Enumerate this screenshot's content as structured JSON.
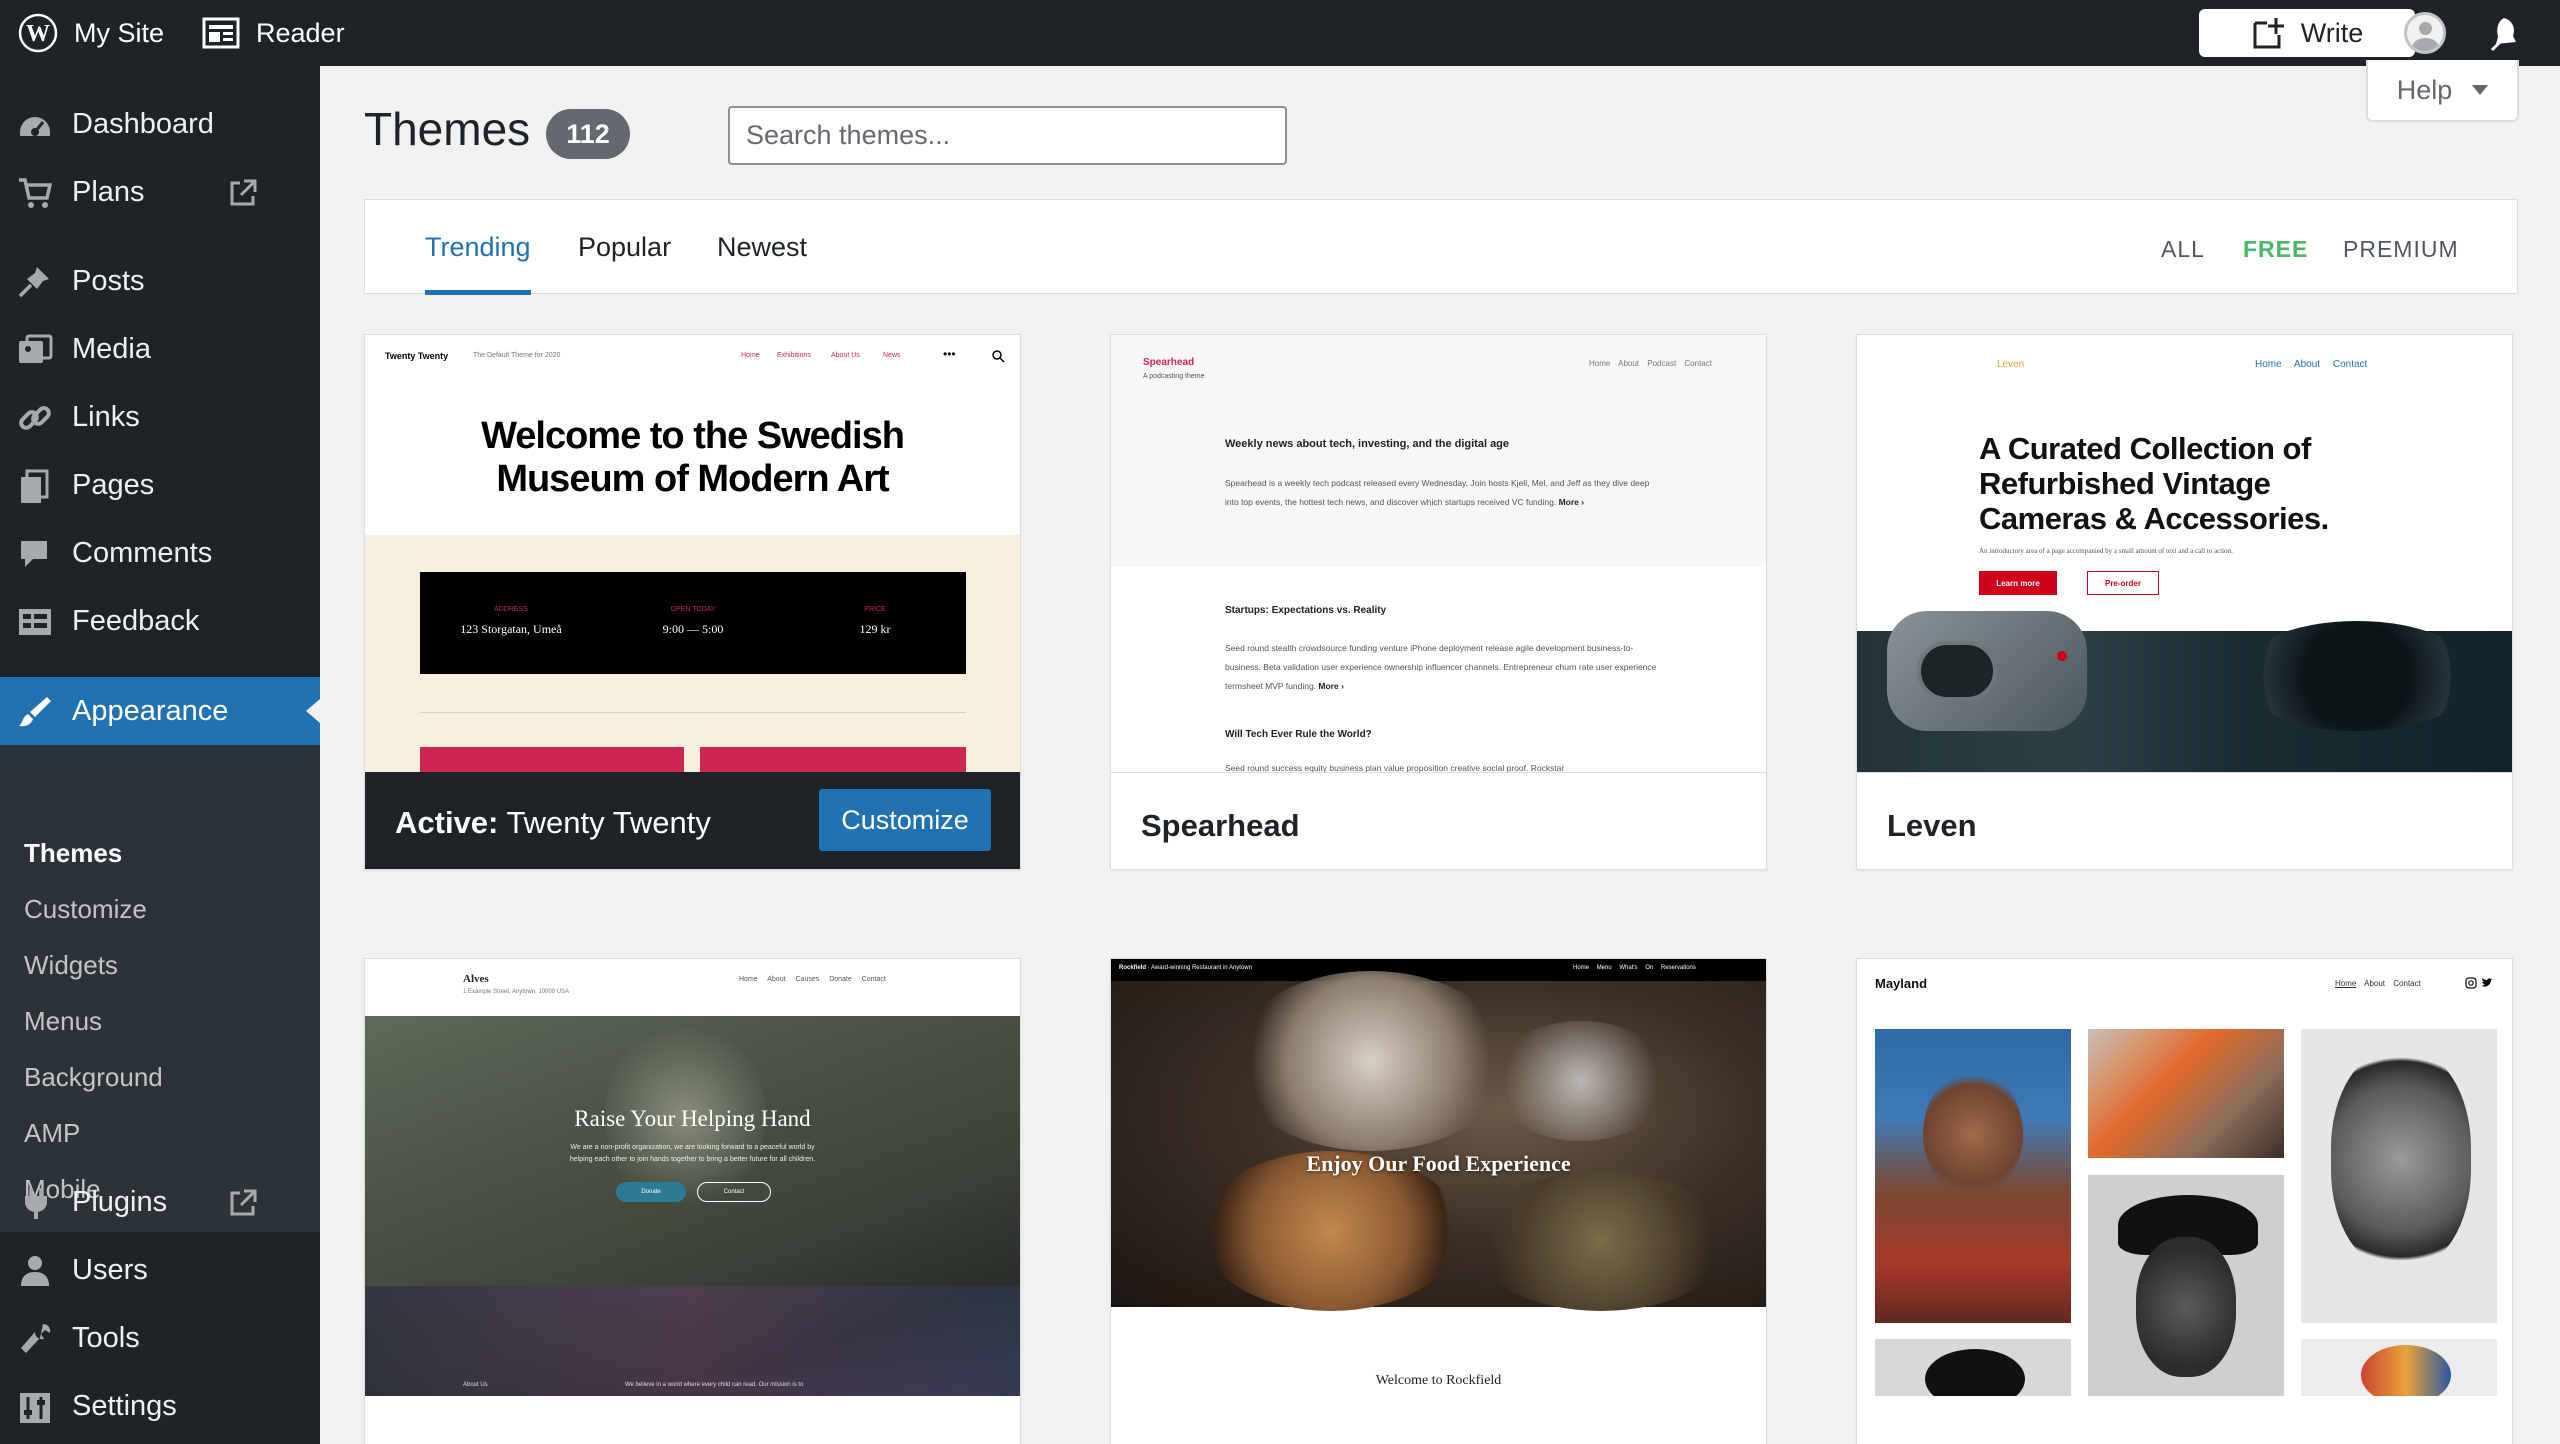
{
  "topbar": {
    "my_site": "My Site",
    "reader": "Reader",
    "write": "Write"
  },
  "sidebar": {
    "items": [
      {
        "label": "Dashboard",
        "icon": "dashboard-icon"
      },
      {
        "label": "Plans",
        "icon": "cart-icon"
      },
      {
        "label": "Posts",
        "icon": "pin-icon"
      },
      {
        "label": "Media",
        "icon": "media-icon"
      },
      {
        "label": "Links",
        "icon": "link-icon"
      },
      {
        "label": "Pages",
        "icon": "pages-icon"
      },
      {
        "label": "Comments",
        "icon": "comment-icon"
      },
      {
        "label": "Feedback",
        "icon": "feedback-icon"
      },
      {
        "label": "Appearance",
        "icon": "brush-icon"
      },
      {
        "label": "Plugins",
        "icon": "plug-icon"
      },
      {
        "label": "Users",
        "icon": "user-icon"
      },
      {
        "label": "Tools",
        "icon": "wrench-icon"
      },
      {
        "label": "Settings",
        "icon": "settings-icon"
      }
    ],
    "submenu": [
      "Themes",
      "Customize",
      "Widgets",
      "Menus",
      "Background",
      "AMP",
      "Mobile"
    ]
  },
  "main": {
    "title": "Themes",
    "count": "112",
    "search_placeholder": "Search themes...",
    "help": "Help",
    "tabs": [
      "Trending",
      "Popular",
      "Newest"
    ],
    "price_filters": [
      "ALL",
      "FREE",
      "PREMIUM"
    ]
  },
  "active_theme": {
    "label_prefix": "Active:",
    "label_name": "Twenty Twenty",
    "customize": "Customize"
  },
  "themes": [
    {
      "name": "Twenty Twenty",
      "preview": {
        "site_title": "Twenty Twenty",
        "tagline": "The Default Theme for 2020",
        "nav": [
          "Home",
          "Exhibitions",
          "About Us",
          "News"
        ],
        "headline_1": "Welcome to the Swedish",
        "headline_2": "Museum of Modern Art",
        "info": [
          {
            "k": "ADDRESS",
            "v": "123 Storgatan, Umeå"
          },
          {
            "k": "OPEN TODAY",
            "v": "9:00 — 5:00"
          },
          {
            "k": "PRICE",
            "v": "129 kr"
          }
        ]
      }
    },
    {
      "name": "Spearhead",
      "preview": {
        "site_title": "Spearhead",
        "tagline": "A podcasting theme",
        "nav": [
          "Home",
          "About",
          "Podcast",
          "Contact"
        ],
        "h1": "Weekly news about tech, investing, and the digital age",
        "p1": "Spearhead is a weekly tech podcast released every Wednesday. Join hosts Kjell, Mel, and Jeff as they dive deep into top events, the hottest tech news, and discover which startups received VC funding.",
        "more": "More ›",
        "h2": "Startups: Expectations vs. Reality",
        "p2": "Seed round stealth crowdsource funding venture iPhone deployment release agile development business-to-business. Beta validation user experience ownership influencer channels. Entrepreneur churn rate user experience termsheet MVP funding.",
        "h3": "Will Tech Ever Rule the World?",
        "p3": "Seed round success equity business plan value proposition creative social proof. Rockstar"
      }
    },
    {
      "name": "Leven",
      "preview": {
        "site_title": "Leven",
        "nav": [
          "Home",
          "About",
          "Contact"
        ],
        "headline_1": "A Curated Collection of",
        "headline_2": "Refurbished Vintage",
        "headline_3": "Cameras & Accessories.",
        "intro": "An introductory area of a page accompanied by a small amount of text and a call to action.",
        "btn1": "Learn more",
        "btn2": "Pre-order"
      }
    },
    {
      "name": "Alves",
      "preview": {
        "site_title": "Alves",
        "address": "1 Example Street, Anytown, 10000 USA",
        "nav": [
          "Home",
          "About",
          "Causes",
          "Donate",
          "Contact"
        ],
        "headline": "Raise Your Helping Hand",
        "text_1": "We are a non-profit organization, we are looking forward to a peaceful world by",
        "text_2": "helping each other to join hands together to bring a better future for all children.",
        "btn1": "Donate",
        "btn2": "Contact",
        "foot_left": "About Us",
        "foot_right": "We believe in a world where every child can read. Our mission is to"
      }
    },
    {
      "name": "Rockfield",
      "preview": {
        "site_title": "Rockfield",
        "tagline": "Award-winning Restaurant in Anytown",
        "nav": [
          "Home",
          "Menu",
          "What's On",
          "Reservations"
        ],
        "headline": "Enjoy Our Food Experience",
        "welcome": "Welcome to Rockfield"
      }
    },
    {
      "name": "Mayland",
      "preview": {
        "site_title": "Mayland",
        "nav": [
          "Home",
          "About",
          "Contact"
        ]
      }
    }
  ],
  "colors": {
    "admin_bg": "#1d2327",
    "accent": "#2271b1",
    "free_green": "#4ab866"
  }
}
